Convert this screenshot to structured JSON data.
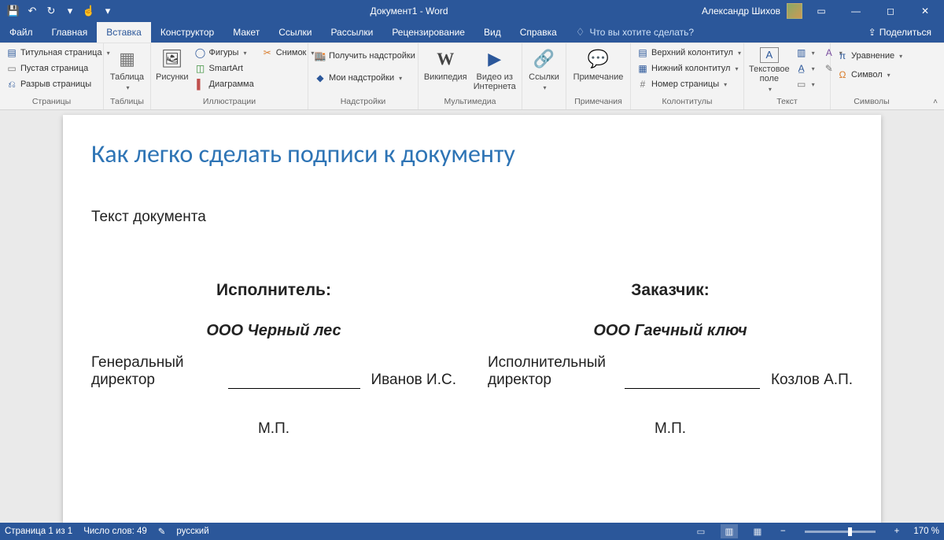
{
  "titlebar": {
    "doc_title": "Документ1  -  Word",
    "user": "Александр Шихов"
  },
  "menu": {
    "tabs": [
      "Файл",
      "Главная",
      "Вставка",
      "Конструктор",
      "Макет",
      "Ссылки",
      "Рассылки",
      "Рецензирование",
      "Вид",
      "Справка"
    ],
    "active_index": 2,
    "tellme": "Что вы хотите сделать?",
    "share": "Поделиться"
  },
  "ribbon": {
    "groups": {
      "pages": {
        "label": "Страницы",
        "cover": "Титульная страница",
        "blank": "Пустая страница",
        "break": "Разрыв страницы"
      },
      "tables": {
        "label": "Таблицы",
        "table": "Таблица"
      },
      "illus": {
        "label": "Иллюстрации",
        "pictures": "Рисунки",
        "shapes": "Фигуры",
        "smartart": "SmartArt",
        "chart": "Диаграмма",
        "screenshot": "Снимок"
      },
      "addins": {
        "label": "Надстройки",
        "get": "Получить надстройки",
        "my": "Мои надстройки"
      },
      "media": {
        "label": "Мультимедиа",
        "wikipedia": "Википедия",
        "video": "Видео из Интернета"
      },
      "links": {
        "label": "",
        "links": "Ссылки"
      },
      "comments": {
        "label": "Примечания",
        "comment": "Примечание"
      },
      "headerf": {
        "label": "Колонтитулы",
        "header": "Верхний колонтитул",
        "footer": "Нижний колонтитул",
        "pagen": "Номер страницы"
      },
      "text": {
        "label": "Текст",
        "textbox": "Текстовое поле"
      },
      "symbols": {
        "label": "Символы",
        "equation": "Уравнение",
        "symbol": "Символ"
      }
    }
  },
  "document": {
    "heading": "Как легко сделать подписи к документу",
    "body": "Текст документа",
    "left": {
      "title": "Исполнитель:",
      "org": "ООО Черный лес",
      "role": "Генеральный директор",
      "name": "Иванов И.С.",
      "mp": "М.П."
    },
    "right": {
      "title": "Заказчик:",
      "org": "ООО Гаечный ключ",
      "role": "Исполнительный директор",
      "name": "Козлов А.П.",
      "mp": "М.П."
    }
  },
  "status": {
    "page": "Страница 1 из 1",
    "words": "Число слов: 49",
    "lang": "русский",
    "zoom": "170 %"
  }
}
